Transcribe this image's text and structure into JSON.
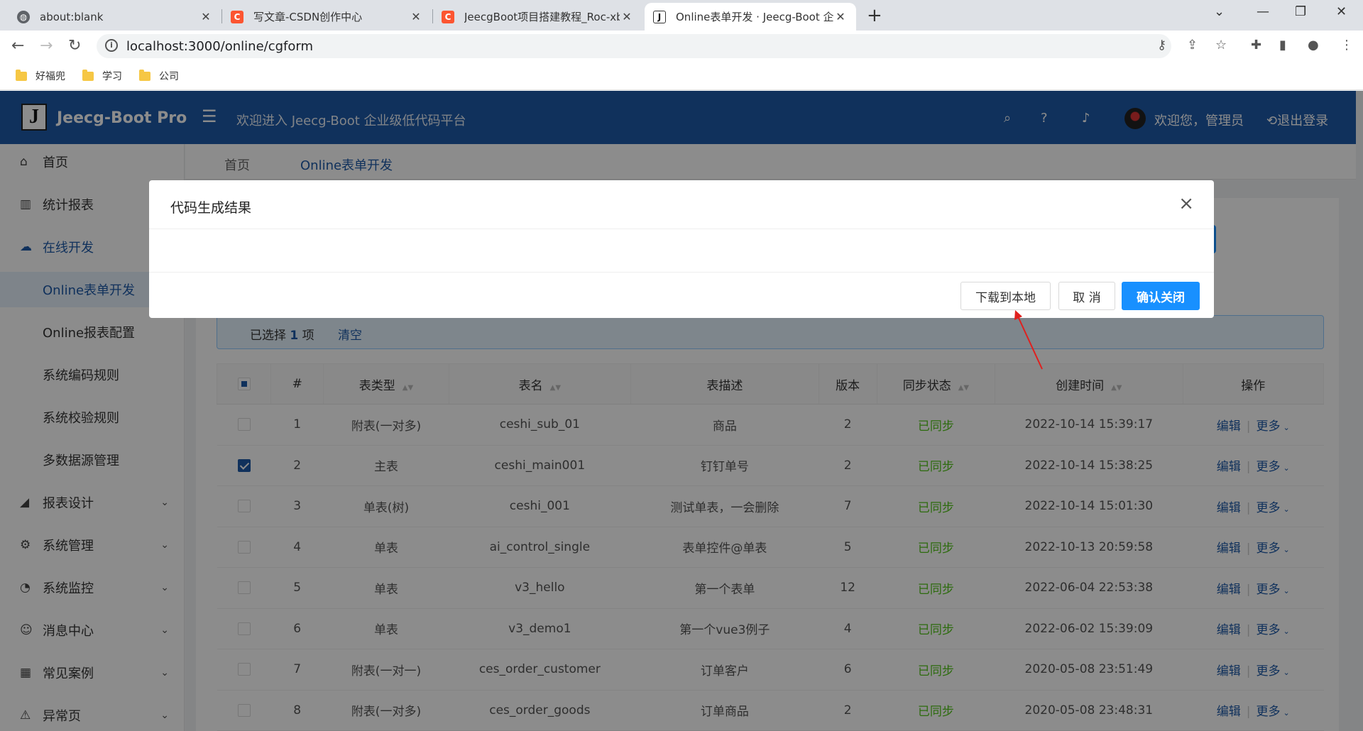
{
  "browser": {
    "tabs": [
      {
        "title": "about:blank",
        "icon": "globe-icon"
      },
      {
        "title": "写文章-CSDN创作中心",
        "icon": "csdn-icon"
      },
      {
        "title": "JeecgBoot项目搭建教程_Roc-xb",
        "icon": "csdn-icon"
      },
      {
        "title": "Online表单开发 · Jeecg-Boot 企",
        "icon": "jeecg-icon"
      }
    ],
    "url": "localhost:3000/online/cgform",
    "bookmarks": [
      "好福兜",
      "学习",
      "公司"
    ]
  },
  "header": {
    "logo_letter": "J",
    "app_name": "Jeecg-Boot Pro",
    "welcome": "欢迎进入 Jeecg-Boot 企业级低代码平台",
    "user": "欢迎您，管理员",
    "logout": "退出登录"
  },
  "sidebar": {
    "items": [
      {
        "label": "首页",
        "icon": "home-icon",
        "type": "top"
      },
      {
        "label": "统计报表",
        "icon": "bar-chart-icon",
        "type": "top"
      },
      {
        "label": "在线开发",
        "icon": "cloud-icon",
        "type": "open"
      },
      {
        "label": "Online表单开发",
        "type": "sub-selected"
      },
      {
        "label": "Online报表配置",
        "type": "sub"
      },
      {
        "label": "系统编码规则",
        "type": "sub"
      },
      {
        "label": "系统校验规则",
        "type": "sub"
      },
      {
        "label": "多数据源管理",
        "type": "sub"
      },
      {
        "label": "报表设计",
        "icon": "area-chart-icon",
        "type": "collapsed"
      },
      {
        "label": "系统管理",
        "icon": "gear-icon",
        "type": "collapsed"
      },
      {
        "label": "系统监控",
        "icon": "dashboard-icon",
        "type": "collapsed"
      },
      {
        "label": "消息中心",
        "icon": "message-icon",
        "type": "collapsed"
      },
      {
        "label": "常见案例",
        "icon": "grid-icon",
        "type": "collapsed"
      },
      {
        "label": "异常页",
        "icon": "warning-icon",
        "type": "collapsed"
      }
    ]
  },
  "breadcrumb": [
    "首页",
    "Online表单开发"
  ],
  "selection": {
    "prefix": "已选择",
    "count": "1",
    "suffix": "项",
    "clear": "清空"
  },
  "table": {
    "columns": [
      "#",
      "表类型",
      "表名",
      "表描述",
      "版本",
      "同步状态",
      "创建时间",
      "操作"
    ],
    "rows": [
      {
        "num": "1",
        "type": "附表(一对多)",
        "name": "ceshi_sub_01",
        "desc": "商品",
        "ver": "2",
        "status": "已同步",
        "time": "2022-10-14 15:39:17",
        "checked": false
      },
      {
        "num": "2",
        "type": "主表",
        "name": "ceshi_main001",
        "desc": "钉钉单号",
        "ver": "2",
        "status": "已同步",
        "time": "2022-10-14 15:38:25",
        "checked": true
      },
      {
        "num": "3",
        "type": "单表(树)",
        "name": "ceshi_001",
        "desc": "测试单表，一会删除",
        "ver": "7",
        "status": "已同步",
        "time": "2022-10-14 15:01:30",
        "checked": false
      },
      {
        "num": "4",
        "type": "单表",
        "name": "ai_control_single",
        "desc": "表单控件@单表",
        "ver": "5",
        "status": "已同步",
        "time": "2022-10-13 20:59:58",
        "checked": false
      },
      {
        "num": "5",
        "type": "单表",
        "name": "v3_hello",
        "desc": "第一个表单",
        "ver": "12",
        "status": "已同步",
        "time": "2022-06-04 22:53:38",
        "checked": false
      },
      {
        "num": "6",
        "type": "单表",
        "name": "v3_demo1",
        "desc": "第一个vue3例子",
        "ver": "4",
        "status": "已同步",
        "time": "2022-06-02 15:39:09",
        "checked": false
      },
      {
        "num": "7",
        "type": "附表(一对一)",
        "name": "ces_order_customer",
        "desc": "订单客户",
        "ver": "6",
        "status": "已同步",
        "time": "2020-05-08 23:51:49",
        "checked": false
      },
      {
        "num": "8",
        "type": "附表(一对多)",
        "name": "ces_order_goods",
        "desc": "订单商品",
        "ver": "2",
        "status": "已同步",
        "time": "2020-05-08 23:48:31",
        "checked": false
      }
    ],
    "op_edit": "编辑",
    "op_more": "更多"
  },
  "modal": {
    "title": "代码生成结果",
    "download": "下载到本地",
    "cancel": "取 消",
    "confirm": "确认关闭"
  },
  "colors": {
    "primary": "#1890ff",
    "header": "#1e5aa8",
    "success": "#52c41a",
    "annotation_arrow": "#e0201e"
  }
}
